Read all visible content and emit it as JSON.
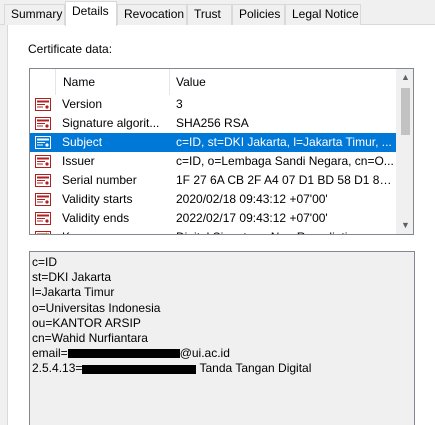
{
  "tabs": [
    {
      "label": "Summary",
      "active": false
    },
    {
      "label": "Details",
      "active": true
    },
    {
      "label": "Revocation",
      "active": false
    },
    {
      "label": "Trust",
      "active": false
    },
    {
      "label": "Policies",
      "active": false
    },
    {
      "label": "Legal Notice",
      "active": false
    }
  ],
  "certificate_data_label": "Certificate data:",
  "list": {
    "columns": {
      "name": "Name",
      "value": "Value"
    },
    "rows": [
      {
        "name": "Version",
        "value": "3",
        "icon": "certificate-field-icon"
      },
      {
        "name": "Signature algorit...",
        "value": "SHA256 RSA",
        "icon": "certificate-field-icon"
      },
      {
        "name": "Subject",
        "value": "c=ID, st=DKI Jakarta, l=Jakarta Timur, ...",
        "icon": "certificate-field-icon",
        "selected": true
      },
      {
        "name": "Issuer",
        "value": "c=ID, o=Lembaga Sandi Negara, cn=O...",
        "icon": "certificate-field-icon"
      },
      {
        "name": "Serial number",
        "value": "1F 27 6A CB 2F A4 07 D1 BD 58 D1 8A D...",
        "icon": "certificate-field-icon"
      },
      {
        "name": "Validity starts",
        "value": "2020/02/18 09:43:12 +07'00'",
        "icon": "certificate-field-icon"
      },
      {
        "name": "Validity ends",
        "value": "2022/02/17 09:43:12 +07'00'",
        "icon": "certificate-field-icon"
      },
      {
        "name": "K...",
        "value": "Digital Signature, Non-Repudiation",
        "icon": "certificate-key-icon"
      }
    ]
  },
  "detail": {
    "lines": [
      "c=ID",
      "st=DKI Jakarta",
      "l=Jakarta Timur",
      "o=Universitas Indonesia",
      "ou=KANTOR ARSIP",
      "cn=Wahid Nurfiantara"
    ],
    "email_prefix": "email=",
    "email_suffix": "@ui.ac.id",
    "oid_prefix": "2.5.4.13=",
    "oid_suffix": " Tanda Tangan Digital"
  },
  "colors": {
    "selection": "#0078d7",
    "border": "#828790",
    "background": "#f0f0f0"
  }
}
